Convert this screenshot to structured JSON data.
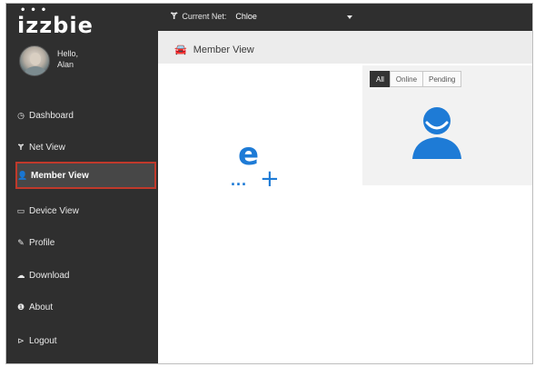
{
  "app": {
    "logo_text": "izzbie"
  },
  "user": {
    "greeting_line1": "Hello,",
    "greeting_line2": "Alan"
  },
  "topbar": {
    "net_label": "Current Net:",
    "net_value": "Chloe"
  },
  "sidebar": {
    "items": [
      {
        "label": "Dashboard",
        "icon": "dashboard-icon",
        "active": false
      },
      {
        "label": "Net View",
        "icon": "net-icon",
        "active": false
      },
      {
        "label": "Member View",
        "icon": "member-icon",
        "active": true
      },
      {
        "label": "Device View",
        "icon": "device-icon",
        "active": false
      },
      {
        "label": "Profile",
        "icon": "profile-icon",
        "active": false
      },
      {
        "label": "Download",
        "icon": "download-icon",
        "active": false
      },
      {
        "label": "About",
        "icon": "info-icon",
        "active": false
      },
      {
        "label": "Logout",
        "icon": "logout-icon",
        "active": false
      }
    ]
  },
  "main": {
    "title": "Member View",
    "filter_tabs": [
      {
        "label": "All",
        "active": true
      },
      {
        "label": "Online",
        "active": false
      },
      {
        "label": "Pending",
        "active": false
      }
    ]
  },
  "colors": {
    "sidebar_bg": "#2f2f2f",
    "active_border": "#c0392b",
    "accent_blue": "#1e7bd6"
  }
}
